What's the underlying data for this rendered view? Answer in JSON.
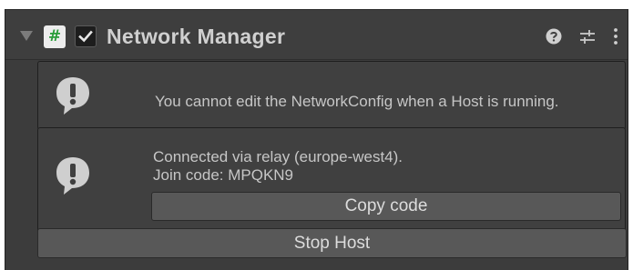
{
  "component": {
    "title": "Network Manager",
    "enabled": true,
    "expanded": true,
    "icons": {
      "foldout": "foldout-arrow-icon",
      "script": "csharp-script-icon",
      "script_glyph": "#",
      "help": "help-icon",
      "presets": "presets-icon",
      "menu": "kebab-menu-icon"
    }
  },
  "warnings": [
    {
      "icon": "warning-icon",
      "lines": [
        "You cannot edit the NetworkConfig when a Host is running."
      ]
    },
    {
      "icon": "warning-icon",
      "lines": [
        "Connected via relay (europe-west4).",
        "Join code: MPQKN9"
      ],
      "button_label": "Copy code"
    }
  ],
  "actions": {
    "stop_host_label": "Stop Host"
  },
  "colors": {
    "panel_bg": "#3c3c3c",
    "helpbox_bg": "#404040",
    "button_bg": "#585858",
    "text": "#c6c6c6",
    "script_icon_glyph": "#2a9d3a"
  }
}
